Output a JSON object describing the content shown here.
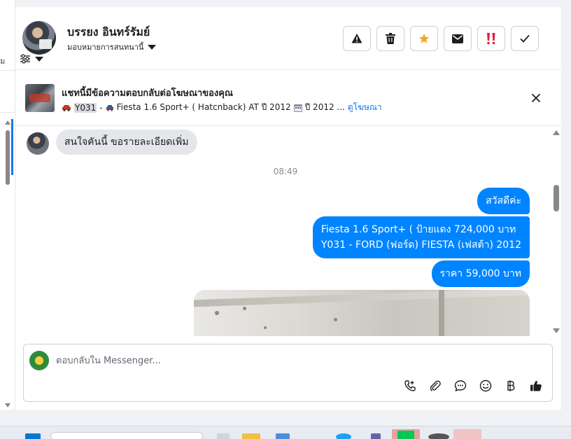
{
  "sidebar": {
    "fragment_text": "ม"
  },
  "header": {
    "contact_name": "บรรยง อินทร์รัมย์",
    "assign_label": "มอบหมายการสนทนานี้"
  },
  "actions": [
    {
      "name": "report-spam",
      "icon": "warning-triangle-icon"
    },
    {
      "name": "delete",
      "icon": "trash-icon"
    },
    {
      "name": "star",
      "icon": "star-icon",
      "color": "#f5a623"
    },
    {
      "name": "mark-unread",
      "icon": "envelope-icon"
    },
    {
      "name": "follow-up",
      "icon": "double-exclamation-icon",
      "color": "#e41e3f"
    },
    {
      "name": "mark-done",
      "icon": "check-icon"
    }
  ],
  "banner": {
    "title": "แชทนี้มีข้อความตอบกลับต่อโฆษณาของคุณ",
    "code": "Y031",
    "separator": "-",
    "model": "Fiesta 1.6 Sport+ ( Hatcnback) AT ปี 2012",
    "year": "ปี 2012 ...",
    "view_ad": "ดูโฆษณา"
  },
  "messages": {
    "incoming_1": "สนใจคันนี้ ขอรายละเอียดเพิ่ม",
    "timestamp": "08:49",
    "outgoing_1": "สวัสดีค่ะ",
    "outgoing_2_line1": "Fiesta 1.6 Sport+ ( ป้ายแดง 724,000 บาท",
    "outgoing_2_line2": "Y031 - FORD (ฟอร์ด) FIESTA (เฟสต้า) 2012",
    "outgoing_3": "ราคา 59,000 บาท"
  },
  "composer": {
    "placeholder": "ตอบกลับใน Messenger..."
  },
  "colors": {
    "accent": "#0084ff",
    "link": "#1877f2",
    "star": "#f5a623",
    "urgent": "#e41e3f"
  }
}
